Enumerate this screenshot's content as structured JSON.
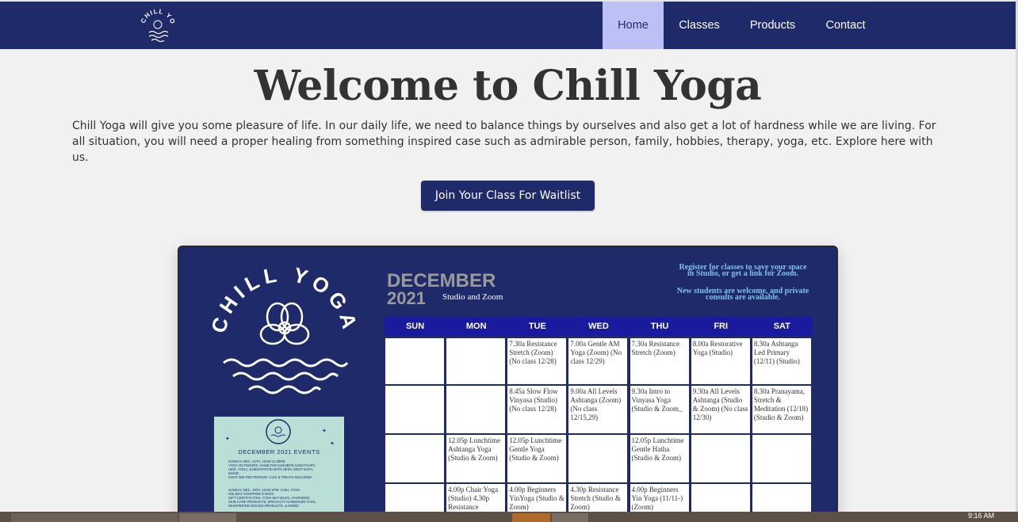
{
  "nav": {
    "items": [
      "Home",
      "Classes",
      "Products",
      "Contact"
    ],
    "active": "Home"
  },
  "hero": {
    "title": "Welcome to Chill Yoga",
    "intro": "Chill Yoga will give you some pleasure of life. In our daily life, we need to balance things by ourselves and also get a lot of hardness while we are living. For all situation, you will need a proper healing from something inspired case such as admirable person, family, hobbies, therapy, yoga, etc. Explore here with us.",
    "cta": "Join Your Class For Waitlist"
  },
  "flyer": {
    "brand": "CHILL YOGA",
    "month": "DECEMBER",
    "year": "2021",
    "subtitle": "Studio and Zoom",
    "register": "Register for classes to save your space in Studio, or get a link for Zoom.",
    "new_students": "New students are welcome, and private consults are available.",
    "days": [
      "SUN",
      "MON",
      "TUE",
      "WED",
      "THU",
      "FRI",
      "SAT"
    ],
    "rows": [
      [
        "",
        "",
        "7.30a Resistance Stretch (Zoom) (No class 12/28)",
        "7.00a Gentle AM Yoga (Zoom) (No class 12/29)",
        "7.30a Resistance Stretch (Zoom)",
        "8.00a  Restorative Yoga (Studio)",
        "8.30a Ashtanga Led Primary (12/11) (Studio)"
      ],
      [
        "",
        "",
        "8.45a  Slow Flow Vinyasa (Studio) (No class 12/28)",
        "9.00a  All Levels Ashtanga (Zoom) (No class 12/15,29)",
        "9.30a Intro to Vinyasa Yoga (Studio & Zoom_",
        "9.30a  All Levels Ashtanga (Studio & Zoom) (No class 12/30)",
        "8.30a Pranayama, Stretch & Meditation (12/18) (Studio & Zoom)"
      ],
      [
        "",
        "12.05p Lunchtime Ashtanga Yoga (Studio & Zoom)",
        "12.05p  Lunchtime Gentle Yoga (Studio & Zoom)",
        "",
        "12.05p Lunchtime Gentle Hatha (Studio & Zoom)",
        "",
        ""
      ],
      [
        "",
        "4.00p Chair Yoga (Studio) 4.30p Resistance",
        "4.00p Beginners YinYoga (Studio & Zoom)",
        "4.30p Resistance Stretch (Studio & Zoom)",
        "4.00p Beginners Yin Yoga (11/11-) (Zoom)",
        "",
        ""
      ]
    ],
    "events": {
      "title": "DECEMBER 2021 EVENTS",
      "lines": [
        "SUNDAY, DEC. 12TH, 10AM 12:30PM",
        "YOGA OUTDOORS: HAMILTON AUDUBON SANCTUARY,",
        "HIKE, YOGA, & MEDITATION WITH HEIDI. WEST BATH,",
        "MAINE",
        "COST: $20 PER PERSON. CHAI & TREATS INCLUDED",
        "",
        "SUNDAY, DEC. 19TH, 10AM 2PM: CHILL YOGA",
        "HOLIDAY SHOPPING EVENT!",
        "GIFT CERTIFICATES, YOGA MAT BAGS, AYURVEDIC",
        "SKIN CARE PRODUCTS, SPECIALTY HANDMADE TAGS,",
        "WHISPERING WOODS PRODUCTS, & MORE!"
      ]
    }
  },
  "taskbar": {
    "clock": "9:16 AM"
  },
  "colors": {
    "navy": "#1f2a6b",
    "nav_active": "#bcc0f5",
    "calendar_header": "#1a1a9e",
    "events_bg": "#b9dfd6"
  }
}
